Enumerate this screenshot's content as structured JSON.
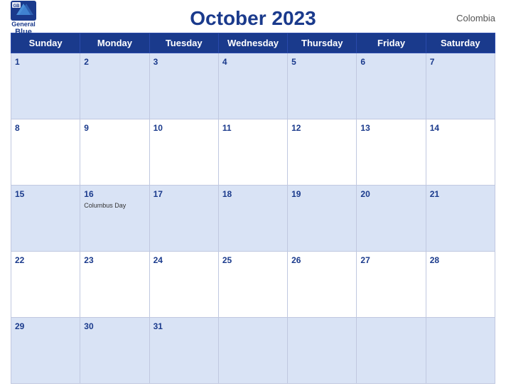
{
  "header": {
    "title": "October 2023",
    "country": "Colombia",
    "logo": {
      "general": "General",
      "blue": "Blue"
    }
  },
  "days_of_week": [
    "Sunday",
    "Monday",
    "Tuesday",
    "Wednesday",
    "Thursday",
    "Friday",
    "Saturday"
  ],
  "weeks": [
    [
      {
        "day": 1,
        "event": ""
      },
      {
        "day": 2,
        "event": ""
      },
      {
        "day": 3,
        "event": ""
      },
      {
        "day": 4,
        "event": ""
      },
      {
        "day": 5,
        "event": ""
      },
      {
        "day": 6,
        "event": ""
      },
      {
        "day": 7,
        "event": ""
      }
    ],
    [
      {
        "day": 8,
        "event": ""
      },
      {
        "day": 9,
        "event": ""
      },
      {
        "day": 10,
        "event": ""
      },
      {
        "day": 11,
        "event": ""
      },
      {
        "day": 12,
        "event": ""
      },
      {
        "day": 13,
        "event": ""
      },
      {
        "day": 14,
        "event": ""
      }
    ],
    [
      {
        "day": 15,
        "event": ""
      },
      {
        "day": 16,
        "event": "Columbus Day"
      },
      {
        "day": 17,
        "event": ""
      },
      {
        "day": 18,
        "event": ""
      },
      {
        "day": 19,
        "event": ""
      },
      {
        "day": 20,
        "event": ""
      },
      {
        "day": 21,
        "event": ""
      }
    ],
    [
      {
        "day": 22,
        "event": ""
      },
      {
        "day": 23,
        "event": ""
      },
      {
        "day": 24,
        "event": ""
      },
      {
        "day": 25,
        "event": ""
      },
      {
        "day": 26,
        "event": ""
      },
      {
        "day": 27,
        "event": ""
      },
      {
        "day": 28,
        "event": ""
      }
    ],
    [
      {
        "day": 29,
        "event": ""
      },
      {
        "day": 30,
        "event": ""
      },
      {
        "day": 31,
        "event": ""
      },
      {
        "day": null,
        "event": ""
      },
      {
        "day": null,
        "event": ""
      },
      {
        "day": null,
        "event": ""
      },
      {
        "day": null,
        "event": ""
      }
    ]
  ]
}
